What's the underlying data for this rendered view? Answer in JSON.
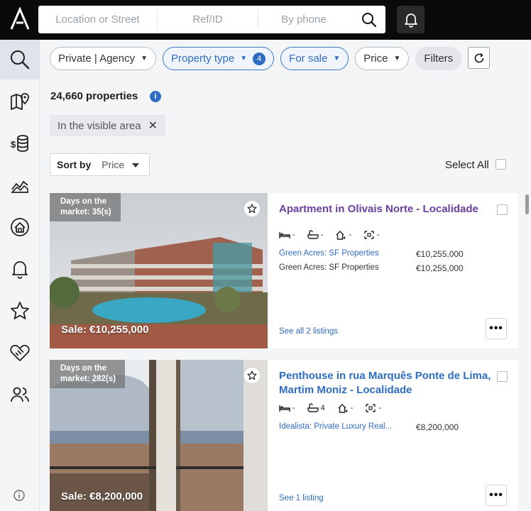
{
  "search": {
    "location_placeholder": "Location or Street",
    "ref_placeholder": "Ref/ID",
    "phone_placeholder": "By phone"
  },
  "sidebar": {
    "items": [
      {
        "icon": "search-icon",
        "active": true
      },
      {
        "icon": "map-icon"
      },
      {
        "icon": "coin-stack-icon"
      },
      {
        "icon": "chart-area-icon"
      },
      {
        "icon": "home-target-icon"
      },
      {
        "icon": "bell-icon"
      },
      {
        "icon": "star-icon"
      },
      {
        "icon": "handshake-icon"
      },
      {
        "icon": "users-icon"
      }
    ]
  },
  "filters": {
    "agency": "Private | Agency",
    "property_type": "Property type",
    "property_type_count": "4",
    "for_sale": "For sale",
    "price": "Price",
    "filters": "Filters"
  },
  "results": {
    "count_label": "24,660 properties",
    "area_chip": "In the visible area",
    "sort_label": "Sort by",
    "sort_value": "Price",
    "select_all": "Select All"
  },
  "listings": [
    {
      "days_line1": "Days on the",
      "days_line2": "market: 35(s)",
      "sale": "Sale: €10,255,000",
      "title_line1": "Apartment in Olivais Norte - Localidade",
      "title_line2": "",
      "beds": "-",
      "baths": "-",
      "area": "-",
      "plot": "-",
      "sources": [
        {
          "name": "Green Acres: SF Properties",
          "price": "€10,255,000",
          "link": true
        },
        {
          "name": "Green Acres: SF Properties",
          "price": "€10,255,000",
          "link": false
        }
      ],
      "see_all": "See all 2 listings"
    },
    {
      "days_line1": "Days on the",
      "days_line2": "market: 282(s)",
      "sale": "Sale: €8,200,000",
      "title_line1": "Penthouse in rua Marquês Ponte de Lima,",
      "title_line2": "Martim Moniz - Localidade",
      "beds": "-",
      "baths": "4",
      "area": "-",
      "plot": "-",
      "sources": [
        {
          "name": "Idealista: Private Luxury Real...",
          "price": "€8,200,000",
          "link": true
        }
      ],
      "see_all": "See 1 listing"
    }
  ],
  "colors": {
    "accent": "#2f6dc2",
    "title_visited": "#6a3fa0",
    "topbar": "#0a0a0a"
  }
}
